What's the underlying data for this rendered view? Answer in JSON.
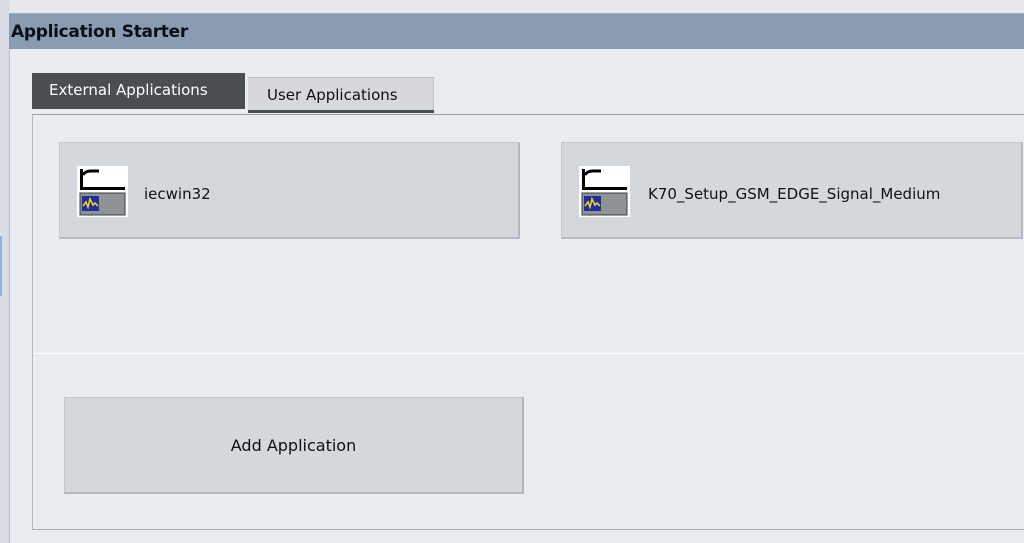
{
  "window": {
    "title": "Application Starter"
  },
  "tabs": [
    {
      "label": "External Applications",
      "active": true
    },
    {
      "label": "User Applications",
      "active": false
    }
  ],
  "applications": [
    {
      "label": "iecwin32",
      "icon": "instrument-app-icon"
    },
    {
      "label": "K70_Setup_GSM_EDGE_Signal_Medium",
      "icon": "instrument-app-icon"
    }
  ],
  "actions": {
    "add_label": "Add Application"
  },
  "colors": {
    "titlebar": "#8a9cb1",
    "active_tab": "#4a4d52",
    "button_face": "#d4d7dc",
    "background": "#e9ecf0"
  }
}
